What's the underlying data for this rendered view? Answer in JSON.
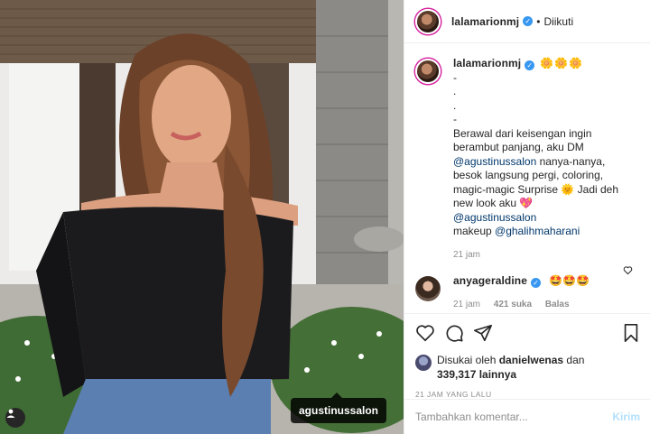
{
  "photo": {
    "tag_label": "agustinussalon"
  },
  "header": {
    "username": "lalamarionmj",
    "separator": "•",
    "follow_status": "Diikuti"
  },
  "caption": {
    "username": "lalamarionmj",
    "flowers": "🌼🌼🌼",
    "dash_lines": [
      "-",
      ".",
      ".",
      "-"
    ],
    "text1": "Berawal dari keisengan ingin berambut panjang, aku DM",
    "mention1": "@agustinussalon",
    "text2": " nanya-nanya, besok langsung pergi, coloring, magic-magic Surprise ",
    "emoji_sun": "🌞",
    "text3": " Jadi deh new look aku ",
    "emoji_heart": "💖",
    "mention2": "@agustinussalon",
    "text4": "makeup ",
    "mention3": "@ghalihmaharani",
    "time": "21 jam"
  },
  "comment": {
    "username": "anyageraldine",
    "text": "🤩🤩🤩",
    "time": "21 jam",
    "likes": "421 suka",
    "reply": "Balas"
  },
  "likes": {
    "prefix": "Disukai oleh ",
    "user": "danielwenas",
    "middle": " dan",
    "count": "339,317 lainnya"
  },
  "timestamp": "21 JAM YANG LALU",
  "add_comment": {
    "placeholder": "Tambahkan komentar...",
    "post_label": "Kirim"
  },
  "colors": {
    "verified": "#3897f0",
    "mention": "#00376b",
    "post_disabled": "#b2dffc"
  }
}
